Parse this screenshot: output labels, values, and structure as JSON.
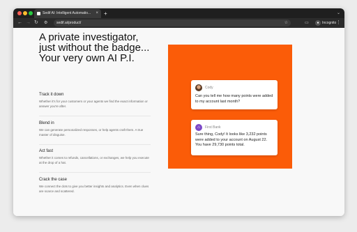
{
  "browser": {
    "tab_title": "Sedif AI: Intelligent Automatio...",
    "tab_close": "×",
    "new_tab": "+",
    "url": "sedif.ai/product/",
    "incognito_label": "Incognito",
    "colors": {
      "red": "#ff5f57",
      "yellow": "#febc2e",
      "green": "#28c840"
    }
  },
  "hero": {
    "headline": [
      "A private investigator,",
      "just without the badge...",
      "Your very own AI P.I."
    ]
  },
  "features": [
    {
      "title": "Track it down",
      "desc": "Whether it's for your customers or your agents we find the exact information or answer you're after."
    },
    {
      "title": "Blend in",
      "desc": "We can generate personalized responses, or help agents craft them. A true master of disguise."
    },
    {
      "title": "Act fast",
      "desc": "Whether it comes to refunds, cancellations, or exchanges, we help you execute at the drop of a hat."
    },
    {
      "title": "Crack the case",
      "desc": "We connect the dots to give you better insights and analytics. Even when clues are scarce and scattered."
    }
  ],
  "chat": {
    "user": {
      "name": "Cody",
      "message": "Can you tell me how many points were added to my account last month?"
    },
    "bank": {
      "name": "First Bank",
      "message": "Sure thing, Cody! It looks like 3,232 points were added to your account on August 22. You have 29,730 points total."
    },
    "accent": "#fb5c08"
  }
}
